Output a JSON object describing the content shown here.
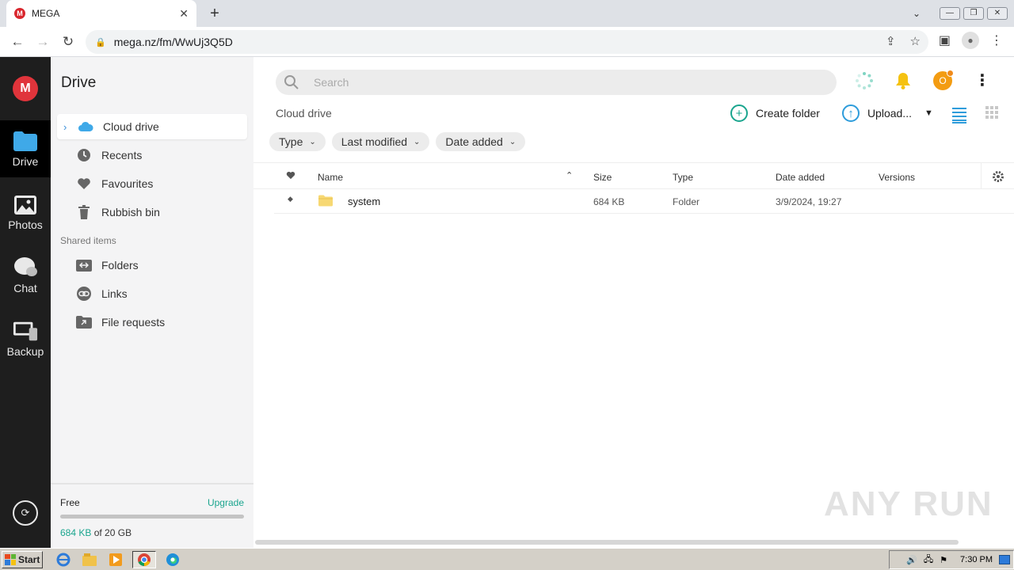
{
  "browser": {
    "tab_title": "MEGA",
    "url": "mega.nz/fm/WwUj3Q5D"
  },
  "rail": {
    "items": [
      {
        "label": "Drive"
      },
      {
        "label": "Photos"
      },
      {
        "label": "Chat"
      },
      {
        "label": "Backup"
      }
    ]
  },
  "sidebar": {
    "title": "Drive",
    "items": [
      {
        "label": "Cloud drive"
      },
      {
        "label": "Recents"
      },
      {
        "label": "Favourites"
      },
      {
        "label": "Rubbish bin"
      }
    ],
    "shared_heading": "Shared items",
    "shared_items": [
      {
        "label": "Folders"
      },
      {
        "label": "Links"
      },
      {
        "label": "File requests"
      }
    ],
    "storage": {
      "plan": "Free",
      "upgrade": "Upgrade",
      "used": "684 KB",
      "of_text": "of 20 GB",
      "used_fraction": 3e-05
    }
  },
  "header": {
    "search_placeholder": "Search",
    "avatar_initial": "O"
  },
  "toolbar": {
    "breadcrumb": "Cloud drive",
    "create_folder": "Create folder",
    "upload": "Upload..."
  },
  "filters": [
    {
      "label": "Type"
    },
    {
      "label": "Last modified"
    },
    {
      "label": "Date added"
    }
  ],
  "table": {
    "columns": {
      "name": "Name",
      "size": "Size",
      "type": "Type",
      "date_added": "Date added",
      "versions": "Versions"
    },
    "rows": [
      {
        "name": "system",
        "size": "684 KB",
        "type": "Folder",
        "date_added": "3/9/2024, 19:27",
        "versions": ""
      }
    ]
  },
  "watermark": "ANY RUN",
  "taskbar": {
    "start": "Start",
    "clock": "7:30 PM"
  },
  "colors": {
    "mega_red": "#e0343b",
    "accent_green": "#1aa58e",
    "accent_blue": "#2d9cdb"
  }
}
